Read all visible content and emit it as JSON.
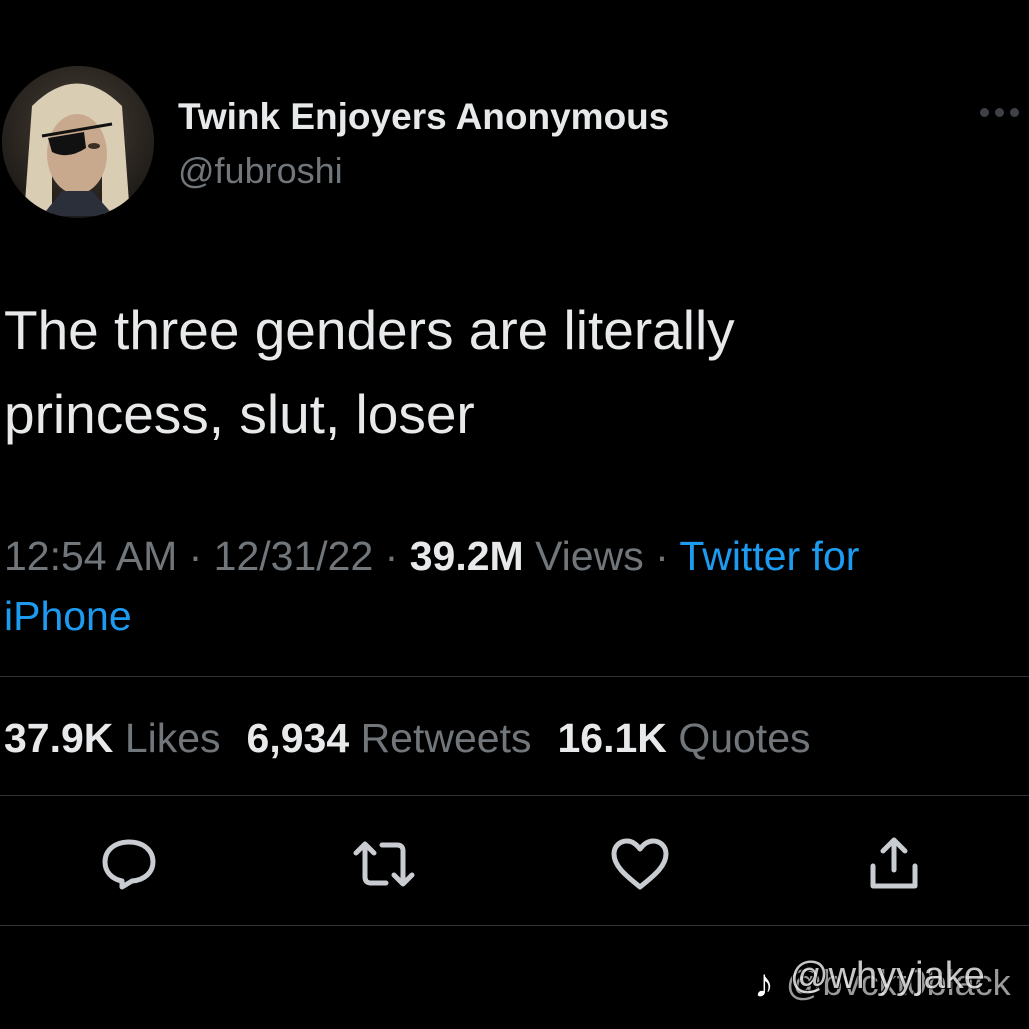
{
  "author": {
    "display_name": "Twink Enjoyers Anonymous",
    "handle": "@fubroshi",
    "avatar_icon": "profile-photo"
  },
  "tweet": {
    "text_line1": "The three genders are literally",
    "text_line2": "princess, slut, loser"
  },
  "meta": {
    "time": "12:54 AM",
    "separator": " · ",
    "date": "12/31/22",
    "views_count": "39.2M",
    "views_label": "Views",
    "source_part1": "Twitter for",
    "source_part2": "iPhone"
  },
  "stats": {
    "likes_count": "37.9K",
    "likes_label": "Likes",
    "retweets_count": "6,934",
    "retweets_label": "Retweets",
    "quotes_count": "16.1K",
    "quotes_label": "Quotes"
  },
  "actions": [
    {
      "icon": "reply-icon"
    },
    {
      "icon": "retweet-icon"
    },
    {
      "icon": "like-icon"
    },
    {
      "icon": "share-icon"
    }
  ],
  "watermark": {
    "logo_glyph": "♪",
    "text_top": "@whyyjake",
    "text_bottom": "@bvckt0black"
  },
  "colors": {
    "background": "#000000",
    "text_primary": "#e7e9ea",
    "text_secondary": "#71767b",
    "link": "#1d9bf0",
    "divider": "#2f3336"
  }
}
